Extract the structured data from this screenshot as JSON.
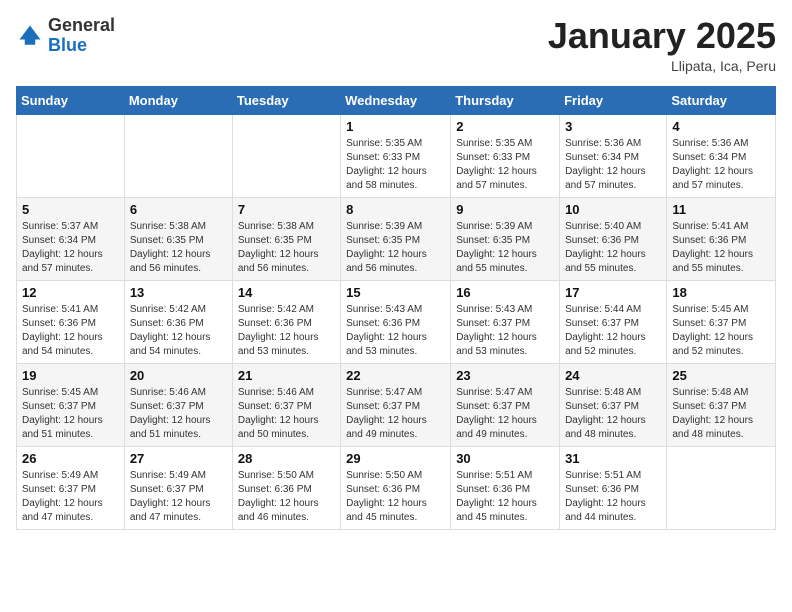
{
  "header": {
    "logo_general": "General",
    "logo_blue": "Blue",
    "month_title": "January 2025",
    "subtitle": "Llipata, Ica, Peru"
  },
  "weekdays": [
    "Sunday",
    "Monday",
    "Tuesday",
    "Wednesday",
    "Thursday",
    "Friday",
    "Saturday"
  ],
  "weeks": [
    [
      {
        "day": "",
        "sunrise": "",
        "sunset": "",
        "daylight": ""
      },
      {
        "day": "",
        "sunrise": "",
        "sunset": "",
        "daylight": ""
      },
      {
        "day": "",
        "sunrise": "",
        "sunset": "",
        "daylight": ""
      },
      {
        "day": "1",
        "sunrise": "Sunrise: 5:35 AM",
        "sunset": "Sunset: 6:33 PM",
        "daylight": "Daylight: 12 hours and 58 minutes."
      },
      {
        "day": "2",
        "sunrise": "Sunrise: 5:35 AM",
        "sunset": "Sunset: 6:33 PM",
        "daylight": "Daylight: 12 hours and 57 minutes."
      },
      {
        "day": "3",
        "sunrise": "Sunrise: 5:36 AM",
        "sunset": "Sunset: 6:34 PM",
        "daylight": "Daylight: 12 hours and 57 minutes."
      },
      {
        "day": "4",
        "sunrise": "Sunrise: 5:36 AM",
        "sunset": "Sunset: 6:34 PM",
        "daylight": "Daylight: 12 hours and 57 minutes."
      }
    ],
    [
      {
        "day": "5",
        "sunrise": "Sunrise: 5:37 AM",
        "sunset": "Sunset: 6:34 PM",
        "daylight": "Daylight: 12 hours and 57 minutes."
      },
      {
        "day": "6",
        "sunrise": "Sunrise: 5:38 AM",
        "sunset": "Sunset: 6:35 PM",
        "daylight": "Daylight: 12 hours and 56 minutes."
      },
      {
        "day": "7",
        "sunrise": "Sunrise: 5:38 AM",
        "sunset": "Sunset: 6:35 PM",
        "daylight": "Daylight: 12 hours and 56 minutes."
      },
      {
        "day": "8",
        "sunrise": "Sunrise: 5:39 AM",
        "sunset": "Sunset: 6:35 PM",
        "daylight": "Daylight: 12 hours and 56 minutes."
      },
      {
        "day": "9",
        "sunrise": "Sunrise: 5:39 AM",
        "sunset": "Sunset: 6:35 PM",
        "daylight": "Daylight: 12 hours and 55 minutes."
      },
      {
        "day": "10",
        "sunrise": "Sunrise: 5:40 AM",
        "sunset": "Sunset: 6:36 PM",
        "daylight": "Daylight: 12 hours and 55 minutes."
      },
      {
        "day": "11",
        "sunrise": "Sunrise: 5:41 AM",
        "sunset": "Sunset: 6:36 PM",
        "daylight": "Daylight: 12 hours and 55 minutes."
      }
    ],
    [
      {
        "day": "12",
        "sunrise": "Sunrise: 5:41 AM",
        "sunset": "Sunset: 6:36 PM",
        "daylight": "Daylight: 12 hours and 54 minutes."
      },
      {
        "day": "13",
        "sunrise": "Sunrise: 5:42 AM",
        "sunset": "Sunset: 6:36 PM",
        "daylight": "Daylight: 12 hours and 54 minutes."
      },
      {
        "day": "14",
        "sunrise": "Sunrise: 5:42 AM",
        "sunset": "Sunset: 6:36 PM",
        "daylight": "Daylight: 12 hours and 53 minutes."
      },
      {
        "day": "15",
        "sunrise": "Sunrise: 5:43 AM",
        "sunset": "Sunset: 6:36 PM",
        "daylight": "Daylight: 12 hours and 53 minutes."
      },
      {
        "day": "16",
        "sunrise": "Sunrise: 5:43 AM",
        "sunset": "Sunset: 6:37 PM",
        "daylight": "Daylight: 12 hours and 53 minutes."
      },
      {
        "day": "17",
        "sunrise": "Sunrise: 5:44 AM",
        "sunset": "Sunset: 6:37 PM",
        "daylight": "Daylight: 12 hours and 52 minutes."
      },
      {
        "day": "18",
        "sunrise": "Sunrise: 5:45 AM",
        "sunset": "Sunset: 6:37 PM",
        "daylight": "Daylight: 12 hours and 52 minutes."
      }
    ],
    [
      {
        "day": "19",
        "sunrise": "Sunrise: 5:45 AM",
        "sunset": "Sunset: 6:37 PM",
        "daylight": "Daylight: 12 hours and 51 minutes."
      },
      {
        "day": "20",
        "sunrise": "Sunrise: 5:46 AM",
        "sunset": "Sunset: 6:37 PM",
        "daylight": "Daylight: 12 hours and 51 minutes."
      },
      {
        "day": "21",
        "sunrise": "Sunrise: 5:46 AM",
        "sunset": "Sunset: 6:37 PM",
        "daylight": "Daylight: 12 hours and 50 minutes."
      },
      {
        "day": "22",
        "sunrise": "Sunrise: 5:47 AM",
        "sunset": "Sunset: 6:37 PM",
        "daylight": "Daylight: 12 hours and 49 minutes."
      },
      {
        "day": "23",
        "sunrise": "Sunrise: 5:47 AM",
        "sunset": "Sunset: 6:37 PM",
        "daylight": "Daylight: 12 hours and 49 minutes."
      },
      {
        "day": "24",
        "sunrise": "Sunrise: 5:48 AM",
        "sunset": "Sunset: 6:37 PM",
        "daylight": "Daylight: 12 hours and 48 minutes."
      },
      {
        "day": "25",
        "sunrise": "Sunrise: 5:48 AM",
        "sunset": "Sunset: 6:37 PM",
        "daylight": "Daylight: 12 hours and 48 minutes."
      }
    ],
    [
      {
        "day": "26",
        "sunrise": "Sunrise: 5:49 AM",
        "sunset": "Sunset: 6:37 PM",
        "daylight": "Daylight: 12 hours and 47 minutes."
      },
      {
        "day": "27",
        "sunrise": "Sunrise: 5:49 AM",
        "sunset": "Sunset: 6:37 PM",
        "daylight": "Daylight: 12 hours and 47 minutes."
      },
      {
        "day": "28",
        "sunrise": "Sunrise: 5:50 AM",
        "sunset": "Sunset: 6:36 PM",
        "daylight": "Daylight: 12 hours and 46 minutes."
      },
      {
        "day": "29",
        "sunrise": "Sunrise: 5:50 AM",
        "sunset": "Sunset: 6:36 PM",
        "daylight": "Daylight: 12 hours and 45 minutes."
      },
      {
        "day": "30",
        "sunrise": "Sunrise: 5:51 AM",
        "sunset": "Sunset: 6:36 PM",
        "daylight": "Daylight: 12 hours and 45 minutes."
      },
      {
        "day": "31",
        "sunrise": "Sunrise: 5:51 AM",
        "sunset": "Sunset: 6:36 PM",
        "daylight": "Daylight: 12 hours and 44 minutes."
      },
      {
        "day": "",
        "sunrise": "",
        "sunset": "",
        "daylight": ""
      }
    ]
  ]
}
